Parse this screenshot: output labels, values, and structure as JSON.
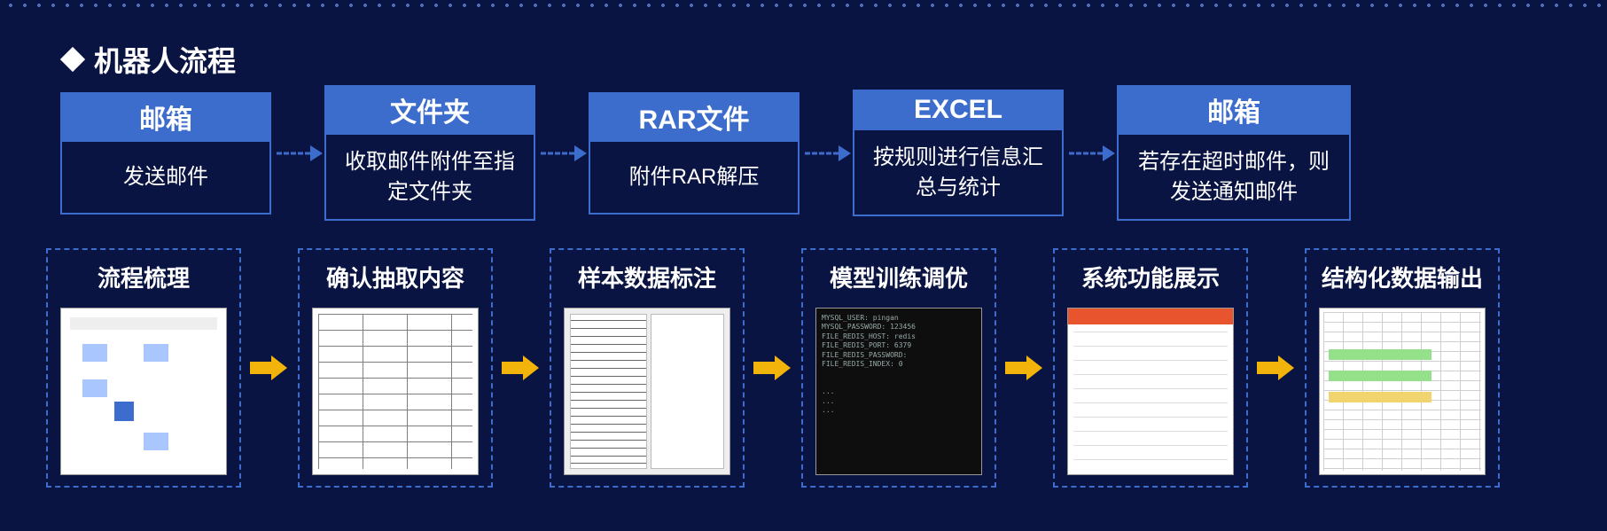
{
  "title": "机器人流程",
  "flow": [
    {
      "head": "邮箱",
      "body": "发送邮件"
    },
    {
      "head": "文件夹",
      "body": "收取邮件附件至指定文件夹"
    },
    {
      "head": "RAR文件",
      "body": "附件RAR解压"
    },
    {
      "head": "EXCEL",
      "body": "按规则进行信息汇总与统计"
    },
    {
      "head": "邮箱",
      "body": "若存在超时邮件，则发送通知邮件"
    }
  ],
  "stages": [
    {
      "title": "流程梳理",
      "thumb": "flowchart"
    },
    {
      "title": "确认抽取内容",
      "thumb": "table"
    },
    {
      "title": "样本数据标注",
      "thumb": "docs"
    },
    {
      "title": "模型训练调优",
      "thumb": "terminal"
    },
    {
      "title": "系统功能展示",
      "thumb": "webui"
    },
    {
      "title": "结构化数据输出",
      "thumb": "sheet"
    }
  ],
  "terminal_text": "MYSQL_USER: pingan\nMYSQL_PASSWORD: 123456\nFILE_REDIS_HOST: redis\nFILE_REDIS_PORT: 6379\nFILE_REDIS_PASSWORD:\nFILE_REDIS_INDEX: 0\n\n\n...\n...\n...",
  "colors": {
    "accent": "#3d6dcc",
    "arrow": "#f2b30a",
    "bg": "#0a1442"
  }
}
